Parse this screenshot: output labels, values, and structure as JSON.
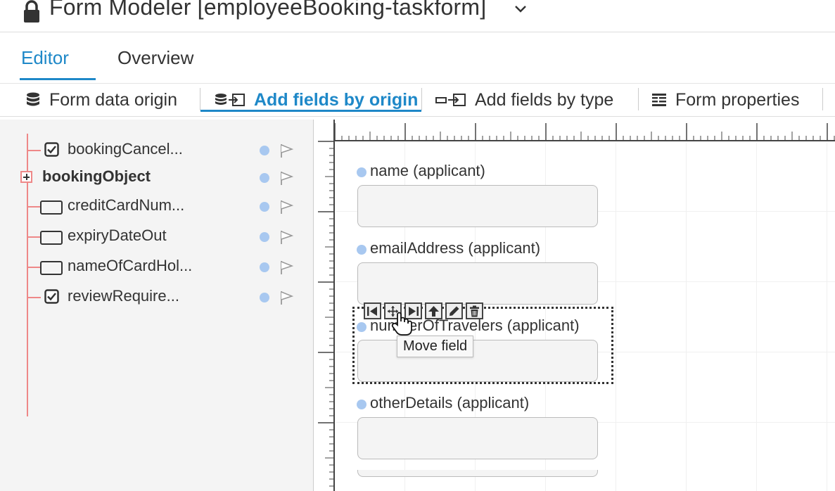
{
  "title": {
    "text": "Form Modeler [employeeBooking-taskform]",
    "lock_icon": "lock-icon",
    "chevron_icon": "chevron-down-icon"
  },
  "tabs": [
    {
      "label": "Editor",
      "active": true
    },
    {
      "label": "Overview",
      "active": false
    }
  ],
  "toolbar": {
    "items": [
      {
        "label": "Form data origin",
        "icon": "database-icon",
        "active": false
      },
      {
        "label": "Add fields by origin",
        "icon": "add-from-source-icon",
        "active": true
      },
      {
        "label": "Add fields by type",
        "icon": "add-field-type-icon",
        "active": false
      },
      {
        "label": "Form properties",
        "icon": "form-properties-icon",
        "active": false
      }
    ],
    "active_color": "#1e88c8"
  },
  "tree": {
    "items": [
      {
        "label": "bookingCancel...",
        "type": "checkbox"
      },
      {
        "label": "bookingObject",
        "type": "group",
        "bold": true
      },
      {
        "label": "creditCardNum...",
        "type": "textbox"
      },
      {
        "label": "expiryDateOut",
        "type": "textbox"
      },
      {
        "label": "nameOfCardHol...",
        "type": "textbox"
      },
      {
        "label": "reviewRequire...",
        "type": "checkbox"
      }
    ]
  },
  "form": {
    "fields": [
      {
        "label": "name (applicant)"
      },
      {
        "label": "emailAddress (applicant)"
      },
      {
        "label": "numberOfTravelers (applicant)"
      },
      {
        "label": "otherDetails (applicant)"
      }
    ],
    "field_toolbar": [
      "move-start-icon",
      "move-icon",
      "move-end-icon",
      "move-up-icon",
      "edit-icon",
      "delete-icon"
    ],
    "tooltip": "Move field"
  }
}
